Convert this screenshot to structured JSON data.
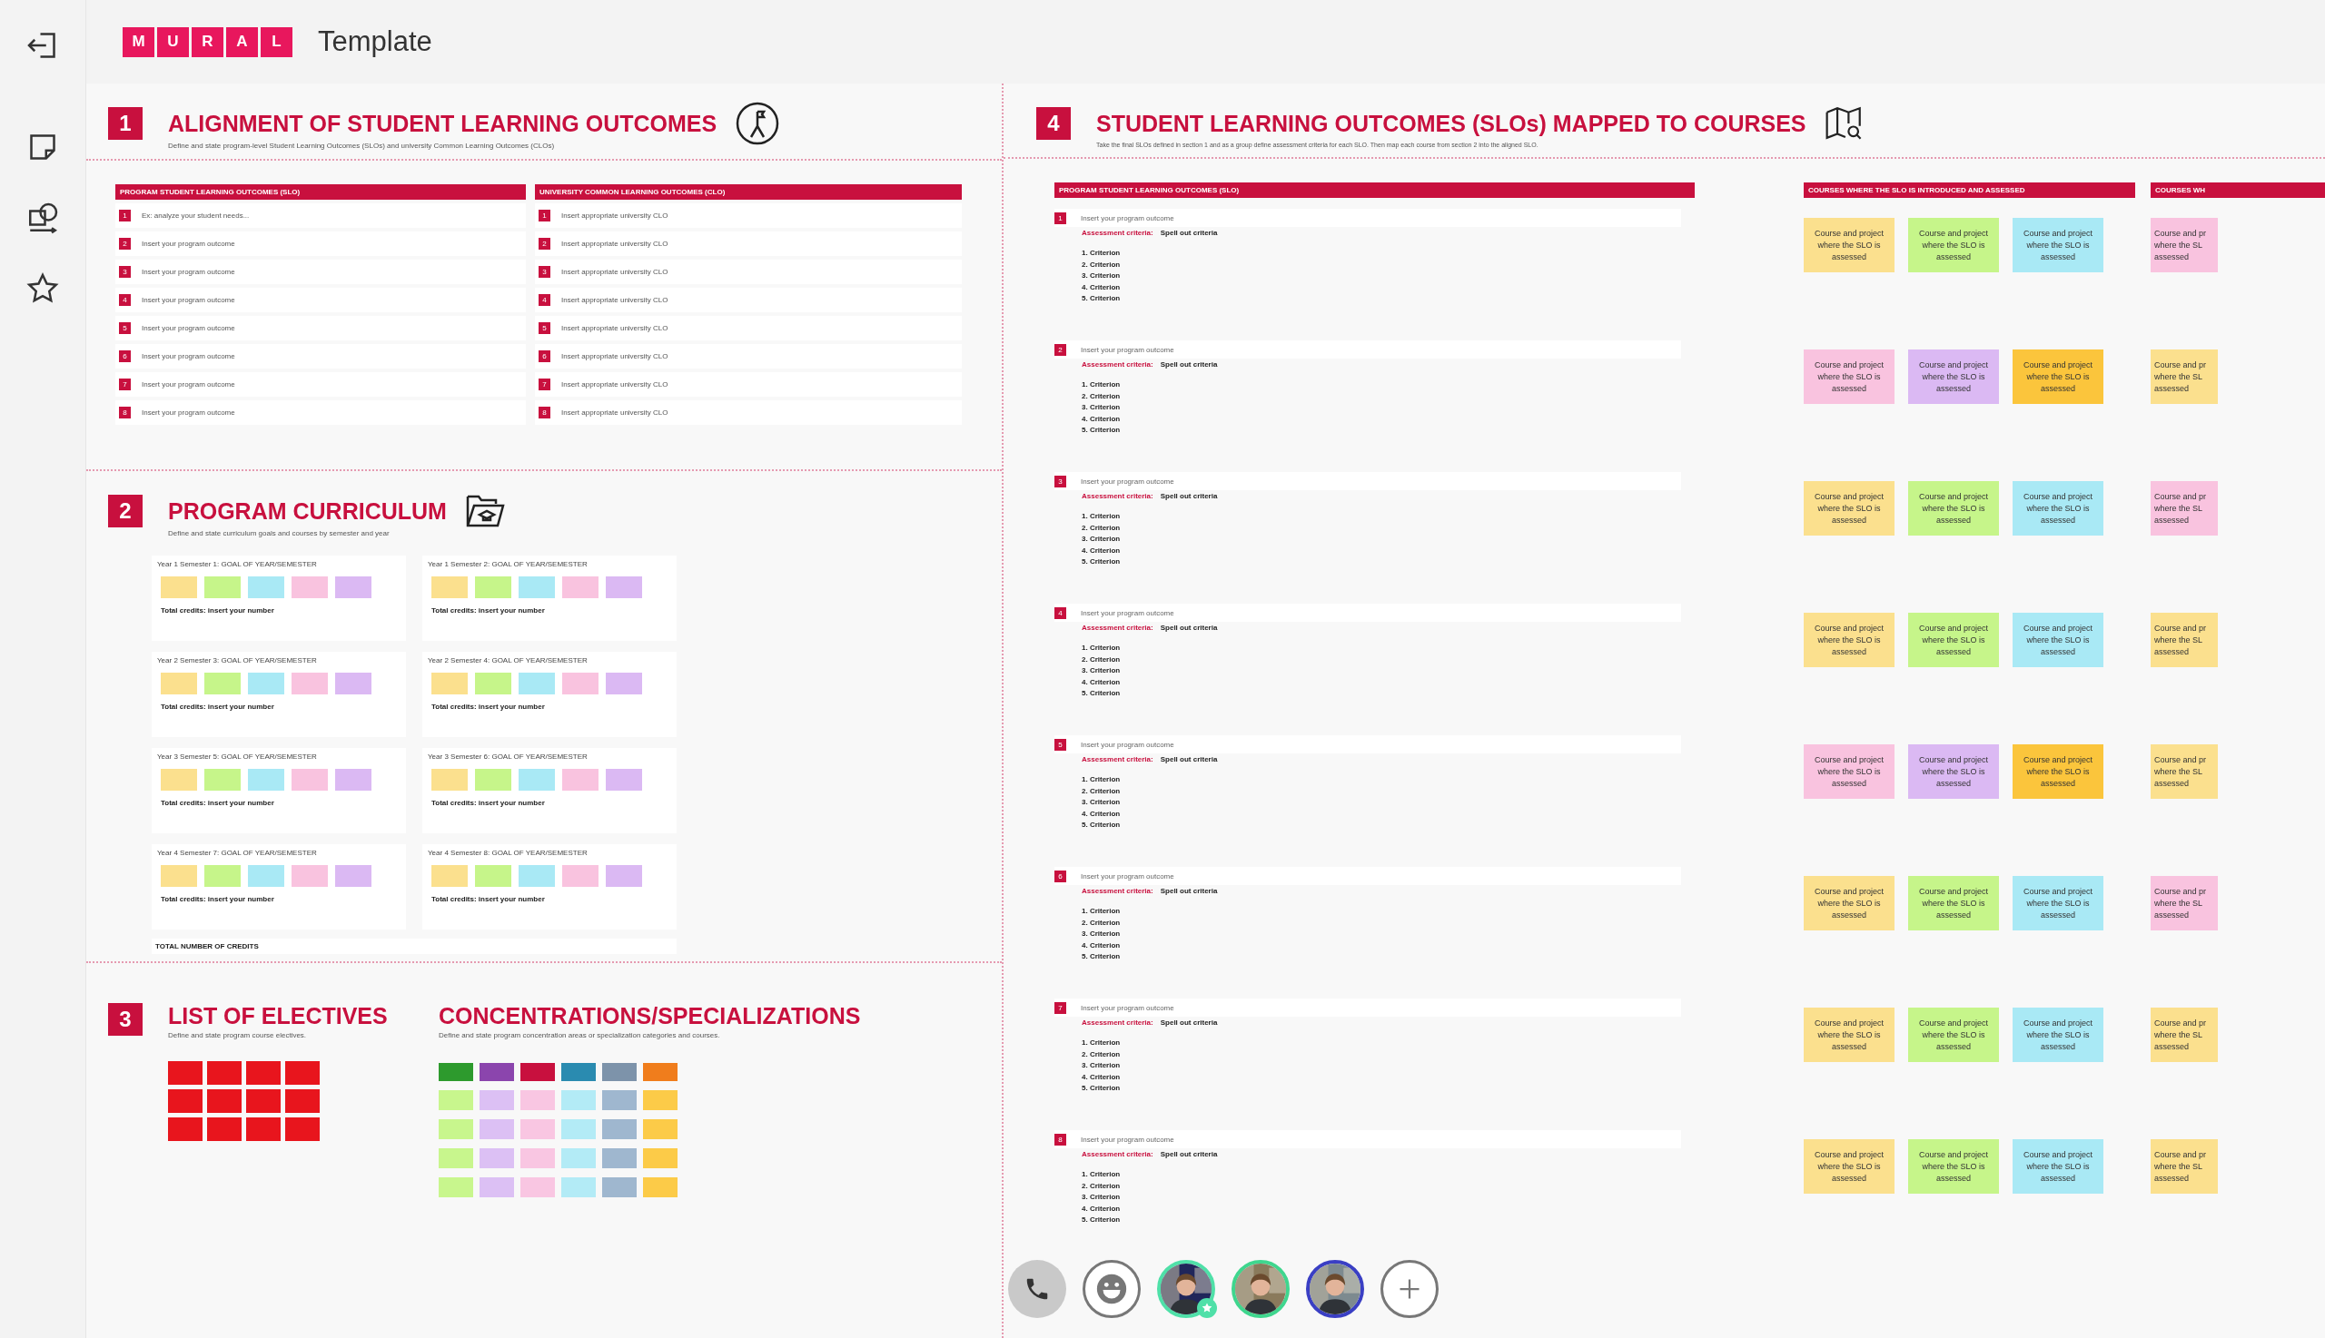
{
  "header": {
    "logo_letters": [
      "M",
      "U",
      "R",
      "A",
      "L"
    ],
    "title": "Template"
  },
  "section_1": {
    "number": "1",
    "title": "ALIGNMENT OF STUDENT LEARNING OUTCOMES",
    "subtitle": "Define and state program-level Student Learning Outcomes (SLOs) and university Common Learning Outcomes (CLOs)",
    "tables": [
      {
        "header": "PROGRAM STUDENT LEARNING OUTCOMES  (SLO)",
        "rows": [
          {
            "number": "1",
            "text": "Ex: analyze your student needs..."
          },
          {
            "number": "2",
            "text": "Insert your program outcome"
          },
          {
            "number": "3",
            "text": "Insert your program outcome"
          },
          {
            "number": "4",
            "text": "Insert your program outcome"
          },
          {
            "number": "5",
            "text": "Insert your program outcome"
          },
          {
            "number": "6",
            "text": "Insert your program outcome"
          },
          {
            "number": "7",
            "text": "Insert your program outcome"
          },
          {
            "number": "8",
            "text": "Insert your program outcome"
          }
        ]
      },
      {
        "header": "UNIVERSITY COMMON LEARNING OUTCOMES  (CLO)",
        "rows": [
          {
            "number": "1",
            "text": "Insert appropriate university CLO"
          },
          {
            "number": "2",
            "text": "Insert appropriate university CLO"
          },
          {
            "number": "3",
            "text": "Insert appropriate university CLO"
          },
          {
            "number": "4",
            "text": "Insert appropriate university CLO"
          },
          {
            "number": "5",
            "text": "Insert appropriate university CLO"
          },
          {
            "number": "6",
            "text": "Insert appropriate university CLO"
          },
          {
            "number": "7",
            "text": "Insert appropriate university CLO"
          },
          {
            "number": "8",
            "text": "Insert appropriate university CLO"
          }
        ]
      }
    ]
  },
  "section_2": {
    "number": "2",
    "title": "PROGRAM CURRICULUM",
    "subtitle": "Define and state curriculum goals and courses by semester and year",
    "semesters": [
      {
        "title": "Year 1 Semester 1: GOAL OF YEAR/SEMESTER",
        "stickies": [
          {
            "color": "#fbe08e"
          },
          {
            "color": "#c6f58a"
          },
          {
            "color": "#a9e9f5"
          },
          {
            "color": "#f9c3df"
          },
          {
            "color": "#dbb9f3"
          }
        ],
        "total": "Total credits: insert your number"
      },
      {
        "title": "Year 1 Semester 2: GOAL OF YEAR/SEMESTER",
        "stickies": [
          {
            "color": "#fbe08e"
          },
          {
            "color": "#c6f58a"
          },
          {
            "color": "#a9e9f5"
          },
          {
            "color": "#f9c3df"
          },
          {
            "color": "#dbb9f3"
          }
        ],
        "total": "Total credits: insert your number"
      },
      {
        "title": "Year 2 Semester 3: GOAL OF YEAR/SEMESTER",
        "stickies": [
          {
            "color": "#fbe08e"
          },
          {
            "color": "#c6f58a"
          },
          {
            "color": "#a9e9f5"
          },
          {
            "color": "#f9c3df"
          },
          {
            "color": "#dbb9f3"
          }
        ],
        "total": "Total credits: insert your number"
      },
      {
        "title": "Year 2 Semester 4: GOAL OF YEAR/SEMESTER",
        "stickies": [
          {
            "color": "#fbe08e"
          },
          {
            "color": "#c6f58a"
          },
          {
            "color": "#a9e9f5"
          },
          {
            "color": "#f9c3df"
          },
          {
            "color": "#dbb9f3"
          }
        ],
        "total": "Total credits: insert your number"
      },
      {
        "title": "Year 3 Semester 5: GOAL OF YEAR/SEMESTER",
        "stickies": [
          {
            "color": "#fbe08e"
          },
          {
            "color": "#c6f58a"
          },
          {
            "color": "#a9e9f5"
          },
          {
            "color": "#f9c3df"
          },
          {
            "color": "#dbb9f3"
          }
        ],
        "total": "Total credits: insert your number"
      },
      {
        "title": "Year 3 Semester 6: GOAL OF YEAR/SEMESTER",
        "stickies": [
          {
            "color": "#fbe08e"
          },
          {
            "color": "#c6f58a"
          },
          {
            "color": "#a9e9f5"
          },
          {
            "color": "#f9c3df"
          },
          {
            "color": "#dbb9f3"
          }
        ],
        "total": "Total credits: insert your number"
      },
      {
        "title": "Year 4 Semester 7: GOAL OF YEAR/SEMESTER",
        "stickies": [
          {
            "color": "#fbe08e"
          },
          {
            "color": "#c6f58a"
          },
          {
            "color": "#a9e9f5"
          },
          {
            "color": "#f9c3df"
          },
          {
            "color": "#dbb9f3"
          }
        ],
        "total": "Total credits: insert your number"
      },
      {
        "title": "Year 4 Semester 8: GOAL OF YEAR/SEMESTER",
        "stickies": [
          {
            "color": "#fbe08e"
          },
          {
            "color": "#c6f58a"
          },
          {
            "color": "#a9e9f5"
          },
          {
            "color": "#f9c3df"
          },
          {
            "color": "#dbb9f3"
          }
        ],
        "total": "Total credits: insert your number"
      }
    ],
    "total_label": "TOTAL NUMBER OF CREDITS"
  },
  "section_3": {
    "number": "3",
    "electives": {
      "title": "LIST OF ELECTIVES",
      "subtitle": "Define and state program course electives.",
      "stickies": [
        {
          "color": "#e8151d"
        },
        {
          "color": "#e8151d"
        },
        {
          "color": "#e8151d"
        },
        {
          "color": "#e8151d"
        },
        {
          "color": "#e8151d"
        },
        {
          "color": "#e8151d"
        },
        {
          "color": "#e8151d"
        },
        {
          "color": "#e8151d"
        },
        {
          "color": "#e8151d"
        },
        {
          "color": "#e8151d"
        },
        {
          "color": "#e8151d"
        },
        {
          "color": "#e8151d"
        }
      ]
    },
    "concentrations": {
      "title": "CONCENTRATIONS/SPECIALIZATIONS",
      "subtitle": "Define and state program concentration areas or specialization categories and courses.",
      "columns": [
        {
          "stickies": [
            {
              "color": "#2d9a2d"
            },
            {
              "color": "#c8f68d"
            },
            {
              "color": "#c8f68d"
            },
            {
              "color": "#c8f68d"
            },
            {
              "color": "#c8f68d"
            }
          ]
        },
        {
          "stickies": [
            {
              "color": "#8b45ad"
            },
            {
              "color": "#dcc0f4"
            },
            {
              "color": "#dcc0f4"
            },
            {
              "color": "#dcc0f4"
            },
            {
              "color": "#dcc0f4"
            }
          ]
        },
        {
          "stickies": [
            {
              "color": "#c8103e"
            },
            {
              "color": "#f9c6e2"
            },
            {
              "color": "#f9c6e2"
            },
            {
              "color": "#f9c6e2"
            },
            {
              "color": "#f9c6e2"
            }
          ]
        },
        {
          "stickies": [
            {
              "color": "#2a8bb0"
            },
            {
              "color": "#b3ebf6"
            },
            {
              "color": "#b3ebf6"
            },
            {
              "color": "#b3ebf6"
            },
            {
              "color": "#b3ebf6"
            }
          ]
        },
        {
          "stickies": [
            {
              "color": "#7d93aa"
            },
            {
              "color": "#9fb7cf"
            },
            {
              "color": "#9fb7cf"
            },
            {
              "color": "#9fb7cf"
            },
            {
              "color": "#9fb7cf"
            }
          ]
        },
        {
          "stickies": [
            {
              "color": "#f07d1c"
            },
            {
              "color": "#fccb48"
            },
            {
              "color": "#fccb48"
            },
            {
              "color": "#fccb48"
            },
            {
              "color": "#fccb48"
            }
          ]
        }
      ]
    }
  },
  "section_4": {
    "number": "4",
    "title": "STUDENT LEARNING OUTCOMES (SLOs)  MAPPED TO COURSES",
    "subtitle": "Take the final SLOs defined in section 1 and as a group define assessment criteria for each SLO. Then map each course from section 2 into the aligned SLO.",
    "table_header": "PROGRAM STUDENT LEARNING OUTCOMES  (SLO)",
    "courses_header": "COURSES WHERE THE SLO IS INTRODUCED  AND ASSESSED",
    "courses_header_partial": "COURSES WH",
    "outcomes": [
      {
        "number": "1",
        "text": "Insert your program outcome",
        "criteria_label": "Assessment criteria:",
        "criteria_value": "Spell out criteria",
        "criteria": [
          "1. Criterion",
          "2. Criterion",
          "3. Criterion",
          "4. Criterion",
          "5. Criterion"
        ],
        "stickies": [
          {
            "color": "#fbe08e",
            "text": "Course and project where the SLO is assessed"
          },
          {
            "color": "#c6f58a",
            "text": "Course and project where the SLO is assessed"
          },
          {
            "color": "#a9e9f5",
            "text": "Course and project where the SLO is assessed"
          }
        ],
        "partial": {
          "color": "#f9c3df",
          "lines": [
            "Course and pr",
            "where the SL",
            "assessed"
          ]
        }
      },
      {
        "number": "2",
        "text": "Insert your program outcome",
        "criteria_label": "Assessment criteria:",
        "criteria_value": "Spell out criteria",
        "criteria": [
          "1. Criterion",
          "2. Criterion",
          "3. Criterion",
          "4. Criterion",
          "5. Criterion"
        ],
        "stickies": [
          {
            "color": "#f9c3df",
            "text": "Course and project where the SLO is assessed"
          },
          {
            "color": "#dbb9f3",
            "text": "Course and project where the SLO is assessed"
          },
          {
            "color": "#fbc53c",
            "text": "Course and project where the SLO is assessed"
          }
        ],
        "partial": {
          "color": "#fbe08e",
          "lines": [
            "Course and pr",
            "where the SL",
            "assessed"
          ]
        }
      },
      {
        "number": "3",
        "text": "Insert your program outcome",
        "criteria_label": "Assessment criteria:",
        "criteria_value": "Spell out criteria",
        "criteria": [
          "1. Criterion",
          "2. Criterion",
          "3. Criterion",
          "4. Criterion",
          "5. Criterion"
        ],
        "stickies": [
          {
            "color": "#fbe08e",
            "text": "Course and project where the SLO is assessed"
          },
          {
            "color": "#c6f58a",
            "text": "Course and project where the SLO is assessed"
          },
          {
            "color": "#a9e9f5",
            "text": "Course and project where the SLO is assessed"
          }
        ],
        "partial": {
          "color": "#f9c3df",
          "lines": [
            "Course and pr",
            "where the SL",
            "assessed"
          ]
        }
      },
      {
        "number": "4",
        "text": "Insert your program outcome",
        "criteria_label": "Assessment criteria:",
        "criteria_value": "Spell out criteria",
        "criteria": [
          "1. Criterion",
          "2. Criterion",
          "3. Criterion",
          "4. Criterion",
          "5. Criterion"
        ],
        "stickies": [
          {
            "color": "#fbe08e",
            "text": "Course and project where the SLO is assessed"
          },
          {
            "color": "#c6f58a",
            "text": "Course and project where the SLO is assessed"
          },
          {
            "color": "#a9e9f5",
            "text": "Course and project where the SLO is assessed"
          }
        ],
        "partial": {
          "color": "#fbe08e",
          "lines": [
            "Course and pr",
            "where the SL",
            "assessed"
          ]
        }
      },
      {
        "number": "5",
        "text": "Insert your program outcome",
        "criteria_label": "Assessment criteria:",
        "criteria_value": "Spell out criteria",
        "criteria": [
          "1. Criterion",
          "2. Criterion",
          "3. Criterion",
          "4. Criterion",
          "5. Criterion"
        ],
        "stickies": [
          {
            "color": "#f9c3df",
            "text": "Course and project where the SLO is assessed"
          },
          {
            "color": "#dbb9f3",
            "text": "Course and project where the SLO is assessed"
          },
          {
            "color": "#fbc53c",
            "text": "Course and project where the SLO is assessed"
          }
        ],
        "partial": {
          "color": "#fbe08e",
          "lines": [
            "Course and pr",
            "where the SL",
            "assessed"
          ]
        }
      },
      {
        "number": "6",
        "text": "Insert your program outcome",
        "criteria_label": "Assessment criteria:",
        "criteria_value": "Spell out criteria",
        "criteria": [
          "1. Criterion",
          "2. Criterion",
          "3. Criterion",
          "4. Criterion",
          "5. Criterion"
        ],
        "stickies": [
          {
            "color": "#fbe08e",
            "text": "Course and project where the SLO is assessed"
          },
          {
            "color": "#c6f58a",
            "text": "Course and project where the SLO is assessed"
          },
          {
            "color": "#a9e9f5",
            "text": "Course and project where the SLO is assessed"
          }
        ],
        "partial": {
          "color": "#f9c3df",
          "lines": [
            "Course and pr",
            "where the SL",
            "assessed"
          ]
        }
      },
      {
        "number": "7",
        "text": "Insert your program outcome",
        "criteria_label": "Assessment criteria:",
        "criteria_value": "Spell out criteria",
        "criteria": [
          "1. Criterion",
          "2. Criterion",
          "3. Criterion",
          "4. Criterion",
          "5. Criterion"
        ],
        "stickies": [
          {
            "color": "#fbe08e",
            "text": "Course and project where the SLO is assessed"
          },
          {
            "color": "#c6f58a",
            "text": "Course and project where the SLO is assessed"
          },
          {
            "color": "#a9e9f5",
            "text": "Course and project where the SLO is assessed"
          }
        ],
        "partial": {
          "color": "#fbe08e",
          "lines": [
            "Course and pr",
            "where the SL",
            "assessed"
          ]
        }
      },
      {
        "number": "8",
        "text": "Insert your program outcome",
        "criteria_label": "Assessment criteria:",
        "criteria_value": "Spell out criteria",
        "criteria": [
          "1. Criterion",
          "2. Criterion",
          "3. Criterion",
          "4. Criterion",
          "5. Criterion"
        ],
        "stickies": [
          {
            "color": "#fbe08e",
            "text": "Course and project where the SLO is assessed"
          },
          {
            "color": "#c6f58a",
            "text": "Course and project where the SLO is assessed"
          },
          {
            "color": "#a9e9f5",
            "text": "Course and project where the SLO is assessed"
          }
        ],
        "partial": {
          "color": "#fbe08e",
          "lines": [
            "Course and pr",
            "where the SL",
            "assessed"
          ]
        }
      }
    ]
  },
  "toolbar": [
    {
      "kind": "call"
    },
    {
      "kind": "emoji"
    },
    {
      "kind": "avatar",
      "color": "#4fe0a8",
      "badge": true
    },
    {
      "kind": "avatar",
      "color": "#3fd68e",
      "badge": false
    },
    {
      "kind": "avatar",
      "color": "#3a3fc4",
      "badge": false
    },
    {
      "kind": "add"
    }
  ]
}
